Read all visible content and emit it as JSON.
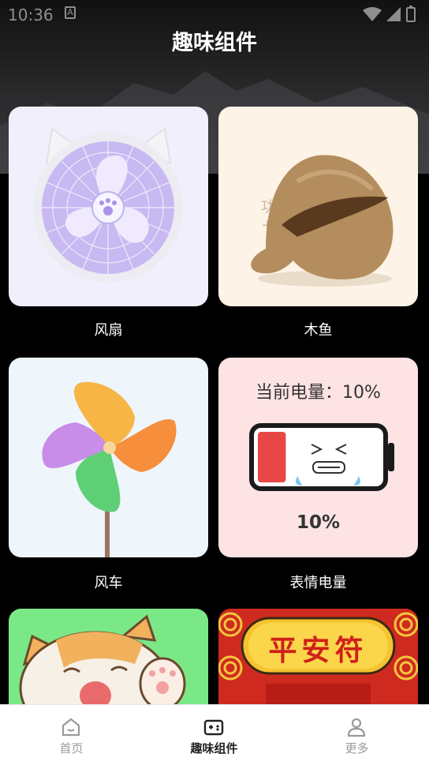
{
  "status": {
    "time": "10:36",
    "notif": "A"
  },
  "header": {
    "title": "趣味组件"
  },
  "widgets": [
    {
      "label": "风扇"
    },
    {
      "label": "木鱼",
      "overlay_text": "功德+1"
    },
    {
      "label": "风车"
    },
    {
      "label": "表情电量",
      "battery_title": "当前电量：10%",
      "battery_percent": "10%",
      "battery_level": 0.1
    },
    {
      "label": ""
    },
    {
      "label": "",
      "sign_text": "平安符"
    }
  ],
  "nav": {
    "tabs": [
      {
        "label": "首页",
        "icon": "home-icon",
        "active": false
      },
      {
        "label": "趣味组件",
        "icon": "gamepad-icon",
        "active": true
      },
      {
        "label": "更多",
        "icon": "user-icon",
        "active": false
      }
    ]
  },
  "colors": {
    "accent": "#222222",
    "inactive": "#9a9a9a",
    "battery_red": "#e84646"
  }
}
